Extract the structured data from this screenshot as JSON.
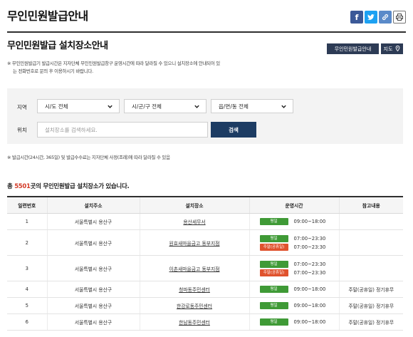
{
  "page_title": "무인민원발급안내",
  "share": [
    {
      "name": "facebook-icon",
      "color": "#3b5998"
    },
    {
      "name": "twitter-icon",
      "color": "#1da1f2"
    },
    {
      "name": "link-icon",
      "color": "#5a8ac9"
    },
    {
      "name": "print-icon",
      "color": "#555555"
    }
  ],
  "section_title": "무인민원발급 설치장소안내",
  "buttons": {
    "guide": "무인민원발급안내",
    "map": "지도"
  },
  "notice": {
    "line1": "※ 무인민원발급기 발급시간은 지자단체 무인민원발급창구 운영시간에 따라 달라질 수 있으니 설치장소에 안내되어 있",
    "line2": "는 전화번호로 문의 후 이용하시기 바랍니다."
  },
  "filter": {
    "region_label": "지역",
    "location_label": "위치",
    "sido": "시/도 전체",
    "sigungu": "시/군/구 전체",
    "eupmyeondong": "읍/면/동 전체",
    "search_placeholder": "설치장소를 검색하세요.",
    "search_button": "검색"
  },
  "sub_note": "※ 발급시간(24시간, 365일) 및 발급수수료는 지자단체 사정(조례)에 따라 달라질 수 있음",
  "count": {
    "prefix": "총 ",
    "number": "5501",
    "suffix": "곳의 무인민원발급 설치장소가 있습니다."
  },
  "table": {
    "headers": [
      "일련번호",
      "설치주소",
      "설치장소",
      "운영시간",
      "참고내용"
    ],
    "badges": {
      "weekday": "평일",
      "holiday": "주말(공휴일)"
    },
    "rows": [
      {
        "no": "1",
        "address": "서울특별시 용산구",
        "place": "용산세무서",
        "hours": [
          {
            "badge": "weekday",
            "time": "09:00~18:00"
          }
        ],
        "note": ""
      },
      {
        "no": "2",
        "address": "서울특별시 용산구",
        "place": "원효새마을금고 동부지점",
        "hours": [
          {
            "badge": "weekday",
            "time": "07:00~23:30"
          },
          {
            "badge": "holiday",
            "time": "07:00~23:30"
          }
        ],
        "note": ""
      },
      {
        "no": "3",
        "address": "서울특별시 용산구",
        "place": "이촌새마을금고 동부지점",
        "hours": [
          {
            "badge": "weekday",
            "time": "07:00~23:30"
          },
          {
            "badge": "holiday",
            "time": "07:00~23:30"
          }
        ],
        "note": ""
      },
      {
        "no": "4",
        "address": "서울특별시 용산구",
        "place": "청파동주민센터",
        "hours": [
          {
            "badge": "weekday",
            "time": "09:00~18:00"
          }
        ],
        "note": "주말(공휴일) 정기휴무"
      },
      {
        "no": "5",
        "address": "서울특별시 용산구",
        "place": "한강로동주민센터",
        "hours": [
          {
            "badge": "weekday",
            "time": "09:00~18:00"
          }
        ],
        "note": "주말(공휴일) 정기휴무"
      },
      {
        "no": "6",
        "address": "서울특별시 용산구",
        "place": "한남동주민센터",
        "hours": [
          {
            "badge": "weekday",
            "time": "09:00~18:00"
          }
        ],
        "note": "주말(공휴일) 정기휴무"
      }
    ]
  }
}
